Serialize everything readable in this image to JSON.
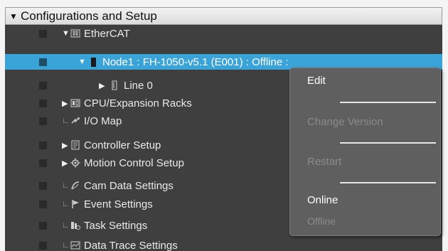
{
  "header": {
    "title": "Configurations and Setup",
    "caret_glyph": "▼"
  },
  "tree": {
    "ethercat": {
      "label": "EtherCAT",
      "icon": "ethercat-icon"
    },
    "node1": {
      "label": "Node1 : FH-1050-v5.1 (E001) : Offline :",
      "icon": "device-icon"
    },
    "line0": {
      "label": "Line 0",
      "icon": "line-icon"
    },
    "cpu_racks": {
      "label": "CPU/Expansion Racks",
      "icon": "rack-icon"
    },
    "io_map": {
      "label": "I/O Map",
      "icon": "io-map-icon"
    },
    "controller_setup": {
      "label": "Controller Setup",
      "icon": "controller-icon"
    },
    "motion_control": {
      "label": "Motion Control Setup",
      "icon": "motion-gear-icon"
    },
    "cam_data": {
      "label": "Cam Data Settings",
      "icon": "cam-icon"
    },
    "event_settings": {
      "label": "Event Settings",
      "icon": "flag-icon"
    },
    "task_settings": {
      "label": "Task Settings",
      "icon": "task-icon"
    },
    "data_trace": {
      "label": "Data Trace Settings",
      "icon": "trace-icon"
    }
  },
  "context_menu": {
    "edit": "Edit",
    "change_version": "Change Version",
    "restart": "Restart",
    "online": "Online",
    "offline": "Offline"
  },
  "colors": {
    "selection": "#3aa4d8",
    "tree_bg": "#3f3f3f",
    "menu_bg": "#5f5f5f"
  }
}
